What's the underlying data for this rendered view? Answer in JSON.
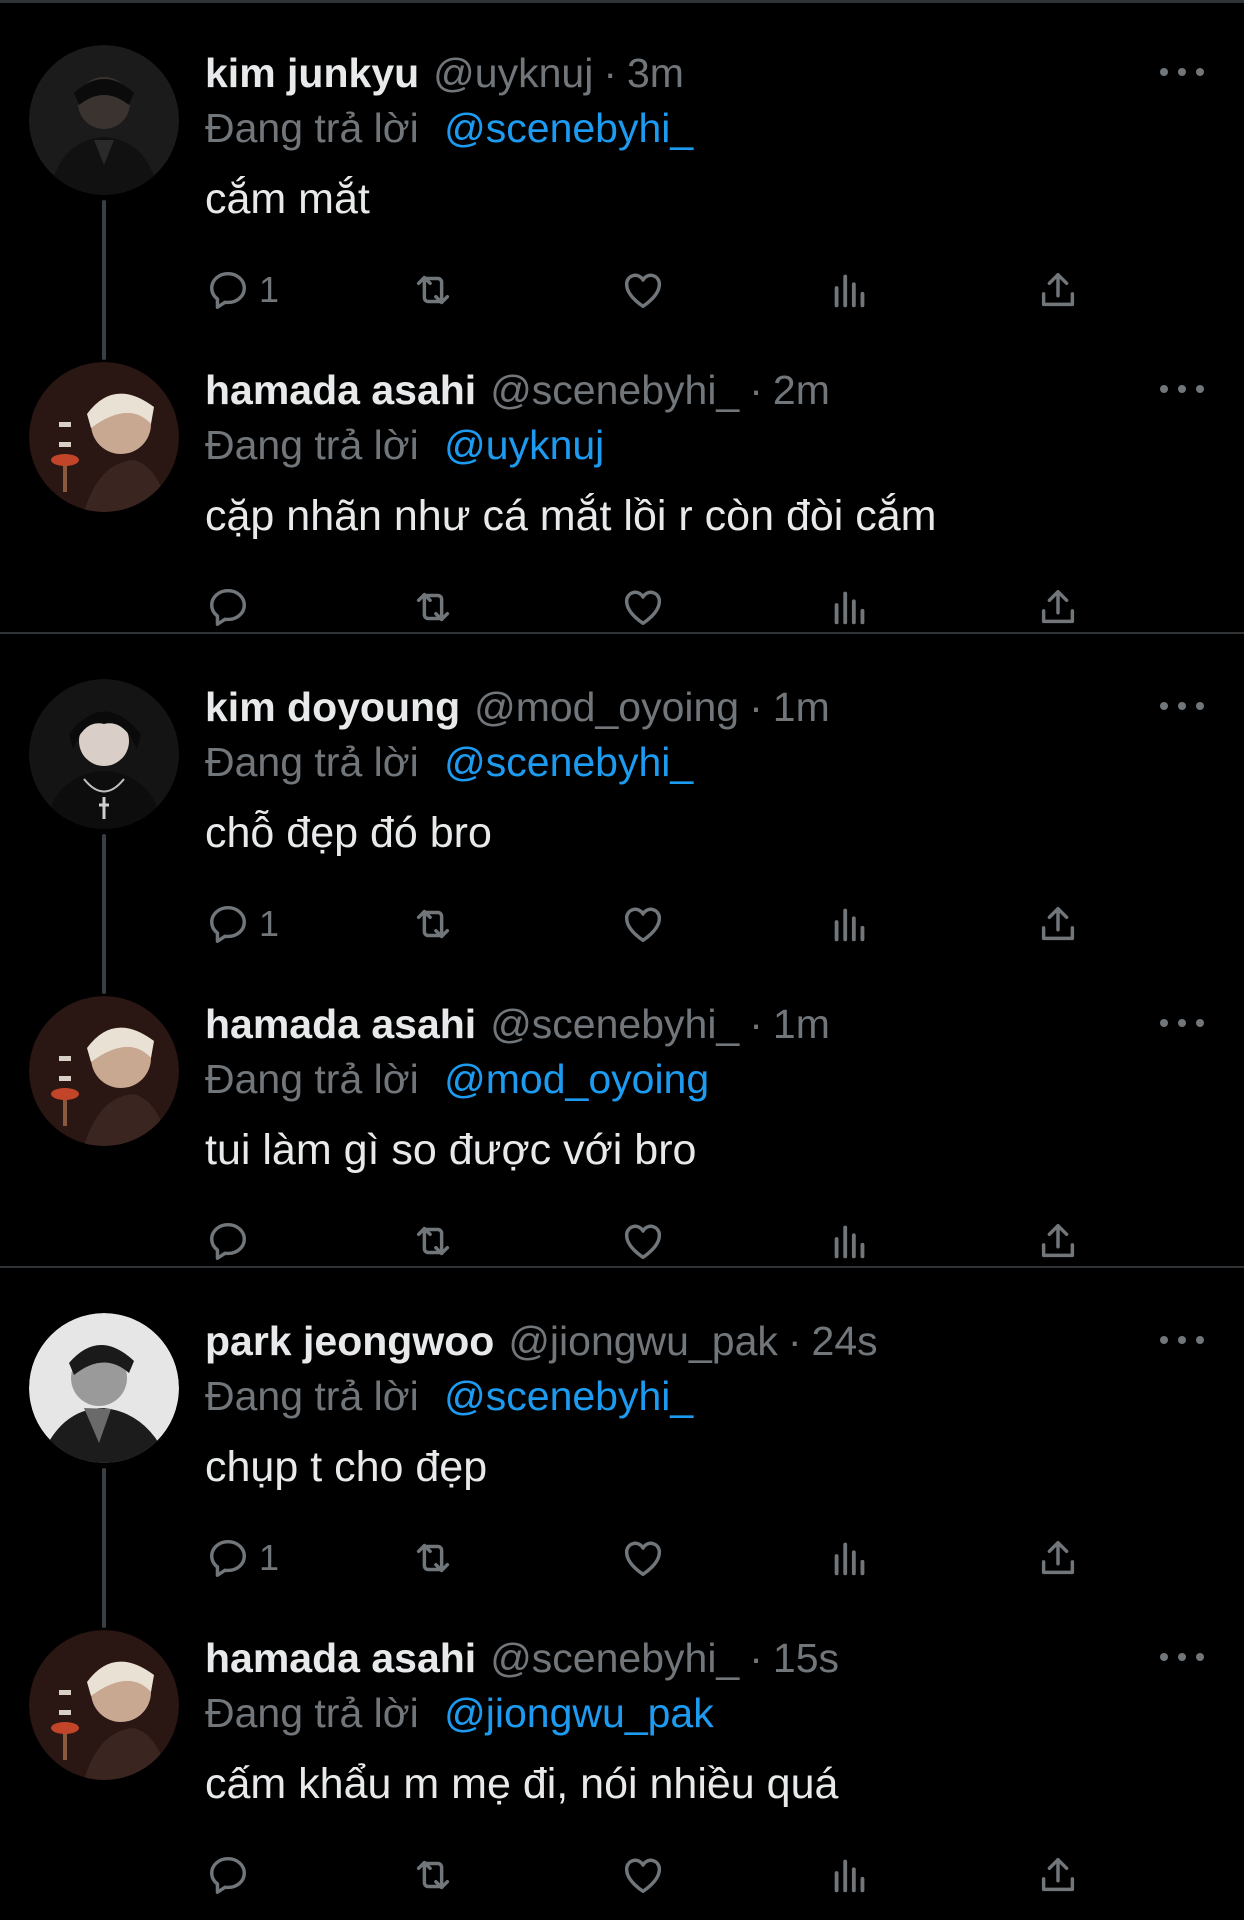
{
  "reply_prefix": "Đang trả lời",
  "threads": [
    {
      "tweets": [
        {
          "display_name": "kim junkyu",
          "handle": "@uyknuj",
          "time": "3m",
          "reply_to": "@scenebyhi_",
          "text": "cắm mắt",
          "reply_count": "1"
        },
        {
          "display_name": "hamada asahi",
          "handle": "@scenebyhi_",
          "time": "2m",
          "reply_to": "@uyknuj",
          "text": "cặp nhãn như cá mắt lồi r còn đòi cắm",
          "reply_count": ""
        }
      ]
    },
    {
      "tweets": [
        {
          "display_name": "kim doyoung",
          "handle": "@mod_oyoing",
          "time": "1m",
          "reply_to": "@scenebyhi_",
          "text": "chỗ đẹp đó bro",
          "reply_count": "1"
        },
        {
          "display_name": "hamada asahi",
          "handle": "@scenebyhi_",
          "time": "1m",
          "reply_to": "@mod_oyoing",
          "text": "tui làm gì so được với bro",
          "reply_count": ""
        }
      ]
    },
    {
      "tweets": [
        {
          "display_name": "park jeongwoo",
          "handle": "@jiongwu_pak",
          "time": "24s",
          "reply_to": "@scenebyhi_",
          "text": "chụp t cho đẹp",
          "reply_count": "1"
        },
        {
          "display_name": "hamada asahi",
          "handle": "@scenebyhi_",
          "time": "15s",
          "reply_to": "@jiongwu_pak",
          "text": "cấm khẩu m mẹ đi, nói nhiều quá",
          "reply_count": ""
        }
      ]
    }
  ],
  "colors": {
    "background": "#000000",
    "text": "#e7e9ea",
    "muted": "#71767b",
    "link": "#1d9bf0",
    "divider": "#2f3336"
  },
  "icons": [
    "more-icon",
    "reply-icon",
    "retweet-icon",
    "like-icon",
    "views-icon",
    "share-icon"
  ]
}
